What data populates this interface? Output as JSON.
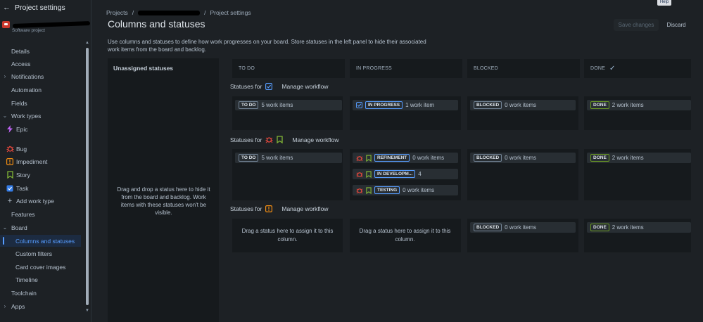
{
  "sidebar": {
    "title": "Project settings",
    "project_subtitle": "Software project",
    "items": [
      {
        "label": "Details"
      },
      {
        "label": "Access"
      },
      {
        "label": "Notifications"
      },
      {
        "label": "Automation"
      },
      {
        "label": "Fields"
      },
      {
        "label": "Work types"
      },
      {
        "label": "Epic"
      },
      {
        "label": "Bug"
      },
      {
        "label": "Impediment"
      },
      {
        "label": "Story"
      },
      {
        "label": "Task"
      },
      {
        "label": "Add work type"
      },
      {
        "label": "Features"
      },
      {
        "label": "Board"
      },
      {
        "label": "Columns and statuses"
      },
      {
        "label": "Custom filters"
      },
      {
        "label": "Card cover images"
      },
      {
        "label": "Timeline"
      },
      {
        "label": "Toolchain"
      },
      {
        "label": "Apps"
      }
    ]
  },
  "header": {
    "breadcrumb_root": "Projects",
    "breadcrumb_sep": "/",
    "breadcrumb_current": "Project settings",
    "title": "Columns and statuses",
    "description": "Use columns and statuses to define how work progresses on your board. Store statuses in the left panel to hide their associated work items from the board and backlog.",
    "save_label": "Save changes",
    "discard_label": "Discard",
    "help_label": "Help"
  },
  "unassigned": {
    "title": "Unassigned statuses",
    "hint": "Drag and drop a status here to hide it from the board and backlog. Work items with these statuses won't be visible."
  },
  "columns": [
    {
      "name": "TO DO"
    },
    {
      "name": "IN PROGRESS"
    },
    {
      "name": "BLOCKED"
    },
    {
      "name": "DONE"
    }
  ],
  "groups": [
    {
      "label": "Statuses for",
      "manage": "Manage workflow"
    },
    {
      "label": "Statuses for",
      "manage": "Manage workflow"
    },
    {
      "label": "Statuses for",
      "manage": "Manage workflow"
    }
  ],
  "cards": {
    "g1_todo": {
      "status": "TO DO",
      "count": "5 work items"
    },
    "g1_inprogress": {
      "status": "IN PROGRESS",
      "count": "1 work item"
    },
    "g1_blocked": {
      "status": "BLOCKED",
      "count": "0 work items"
    },
    "g1_done": {
      "status": "DONE",
      "count": "2 work items"
    },
    "g2_todo": {
      "status": "TO DO",
      "count": "5 work items"
    },
    "g2_refinement": {
      "status": "REFINEMENT",
      "count": "0 work items"
    },
    "g2_indev": {
      "status": "IN DEVELOPM...",
      "count": "4"
    },
    "g2_testing": {
      "status": "TESTING",
      "count": "0 work items"
    },
    "g2_blocked": {
      "status": "BLOCKED",
      "count": "0 work items"
    },
    "g2_done": {
      "status": "DONE",
      "count": "2 work items"
    },
    "g3_blocked": {
      "status": "BLOCKED",
      "count": "0 work items"
    },
    "g3_done": {
      "status": "DONE",
      "count": "2 work items"
    }
  },
  "drop_hint": "Drag a status here to assign it to this column.",
  "colors": {
    "accent": "#579dff",
    "bug": "#e2483d",
    "story": "#82b536",
    "impediment": "#f18d13",
    "epic": "#bf63f3"
  }
}
